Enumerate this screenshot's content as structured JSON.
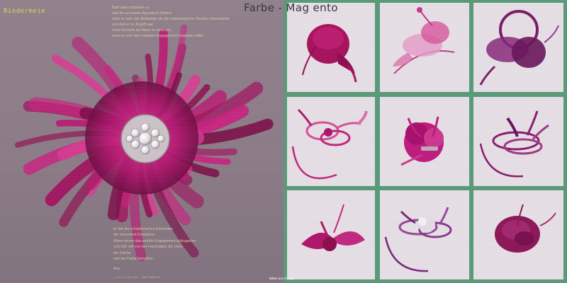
{
  "overlay": {
    "title": "Farbe - Mag ento",
    "corner_label": "Biedermeie"
  },
  "article": {
    "top_lines": [
      "Bald aber entdeckte er,",
      "daß ihn an seinen figurativen Bildern",
      "nicht so sehr das Beiläufige als die mathematische Struktur interessierte",
      "und daß er im Begriff war,",
      "seine Einsicht als Maler zu verlieren,",
      "wenn er sich dem sozialen Engagement hingeben sollte."
    ],
    "bottom_lines": [
      "Er hat die schöpferischen Einsichten",
      "der Vorsortiert Deviations",
      "Wenn immer das weithin Engagement aufzugeben",
      "und sich voll von der Faszination der Linie,",
      "der Fläche",
      "und der Farbe hinreißen."
    ],
    "footnote": "Aus",
    "footnote2": "— D. A. S. Ha. D.E. -- 1987 /Seite 14"
  },
  "source_caption": "Bilder aus Google",
  "colors": {
    "left_bg": "#8a7a86",
    "frame": "#5a9a78",
    "tile_bg": "#e7e0e6",
    "magenta": "#b0186e",
    "pink": "#d8509a",
    "purple": "#7a1f6a",
    "text_gold": "#d8c6a0"
  },
  "products": [
    {
      "name": "magenta-pillbox-fascinator"
    },
    {
      "name": "pink-mesh-bow-fascinator"
    },
    {
      "name": "purple-loop-fascinator"
    },
    {
      "name": "pink-feather-loop-headband"
    },
    {
      "name": "magenta-flower-brooch-clip"
    },
    {
      "name": "purple-sinamay-loop-headband"
    },
    {
      "name": "magenta-bow-hatinator"
    },
    {
      "name": "lilac-flower-loop-headband"
    },
    {
      "name": "burgundy-rose-fascinator"
    }
  ]
}
